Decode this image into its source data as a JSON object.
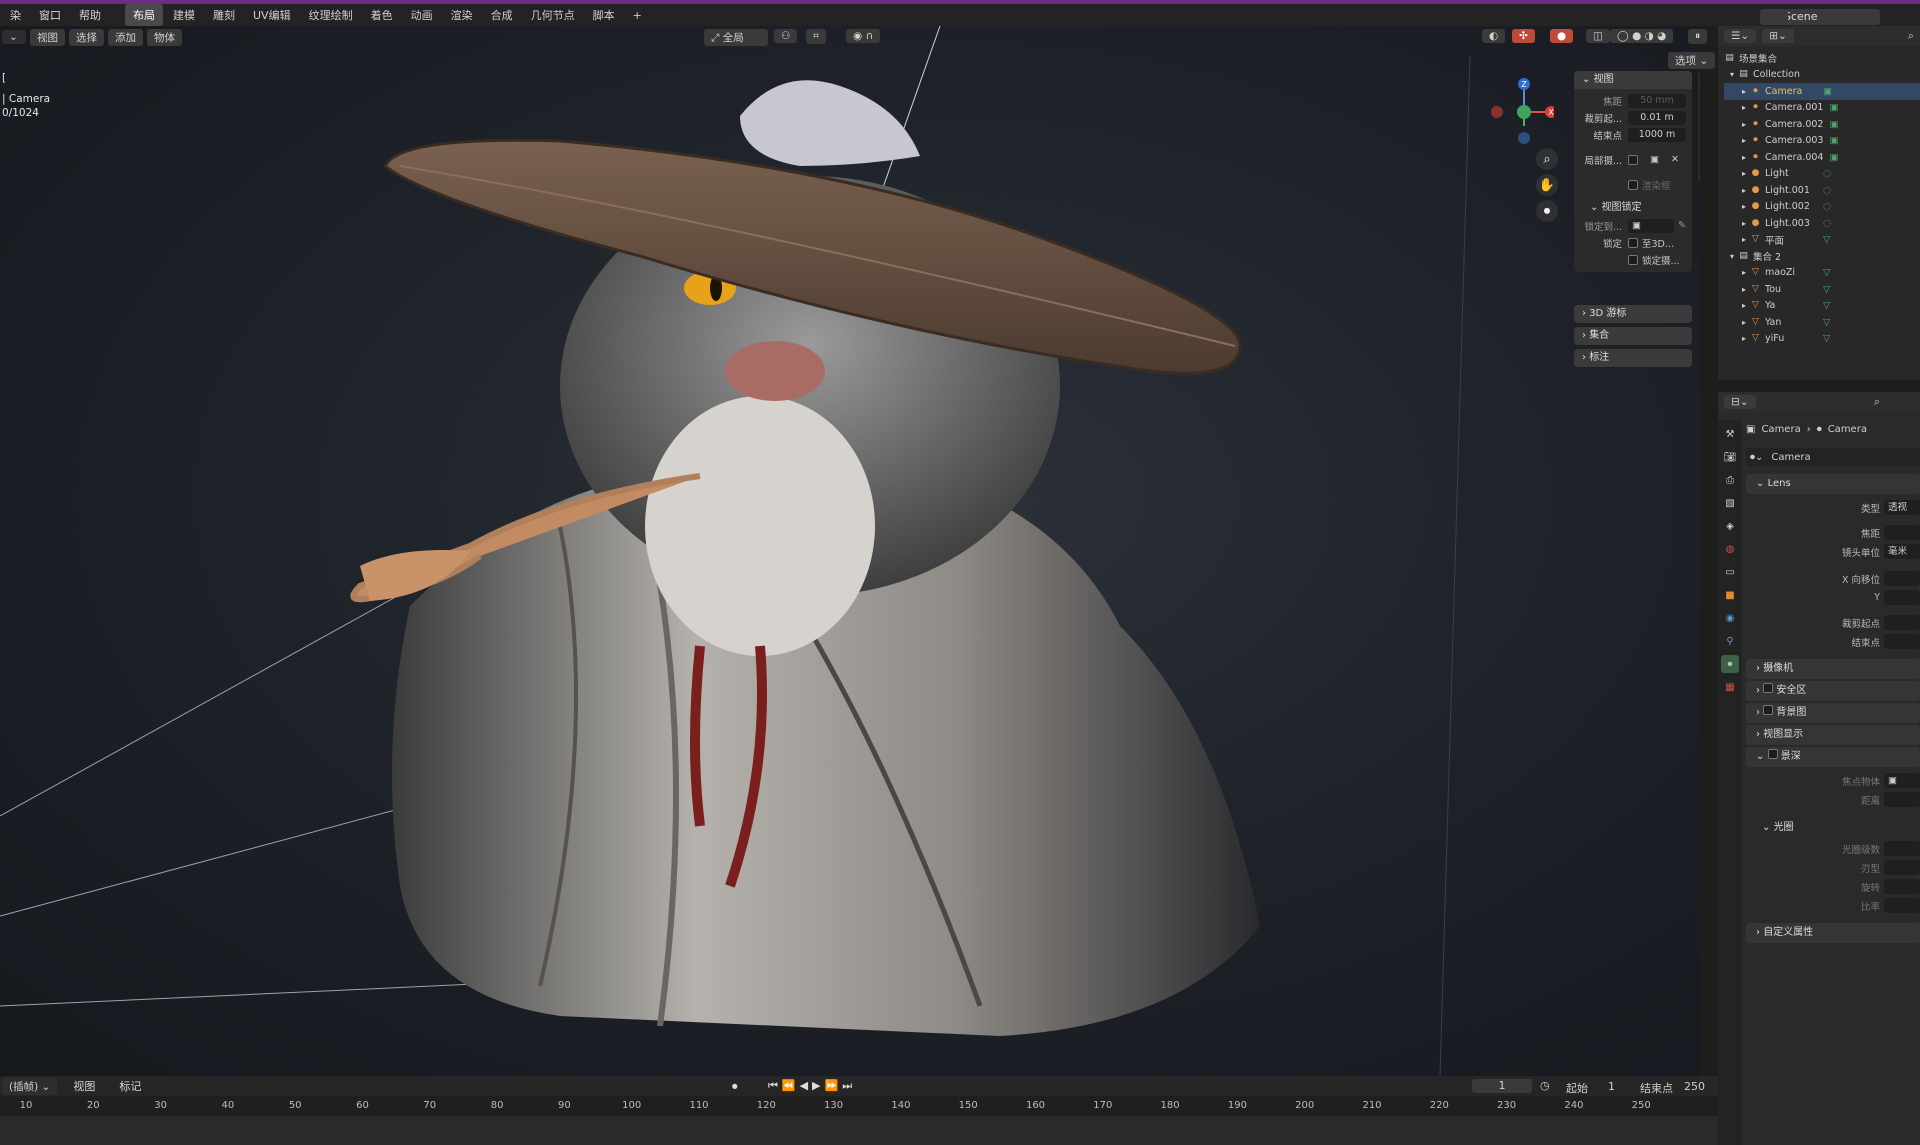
{
  "menus": [
    "染",
    "窗口",
    "帮助"
  ],
  "workspaces": [
    "布局",
    "建模",
    "雕刻",
    "UV编辑",
    "纹理绘制",
    "着色",
    "动画",
    "渲染",
    "合成",
    "几何节点",
    "脚本"
  ],
  "active_workspace": "布局",
  "add_tab": "+",
  "scene_name": "Scene",
  "viewport": {
    "header_items": [
      "视图",
      "选择",
      "添加",
      "物体"
    ],
    "transform_label": "全局",
    "options_label": "选项",
    "overlay_text": [
      "[",
      "| Camera",
      "0/1024"
    ]
  },
  "npanel": {
    "view_header": "视图",
    "focal_label": "焦距",
    "focal_value": "50 mm",
    "clip_start_label": "裁剪起...",
    "clip_start_value": "0.01 m",
    "clip_end_label": "结束点",
    "clip_end_value": "1000 m",
    "local_camera_label": "局部摄...",
    "render_region_label": "渲染框",
    "view_lock_header": "视图锁定",
    "lock_to_label": "锁定到...",
    "lock_label": "锁定",
    "lock_3d_label": "至3D...",
    "lock_camera_label": "锁定摄...",
    "cursor_header": "3D 游标",
    "collections_header": "集合",
    "annotations_header": "标注"
  },
  "outliner": {
    "root": "场景集合",
    "collection1": "Collection",
    "items1": [
      {
        "name": "Camera",
        "type": "camera",
        "selected": true
      },
      {
        "name": "Camera.001",
        "type": "camera"
      },
      {
        "name": "Camera.002",
        "type": "camera"
      },
      {
        "name": "Camera.003",
        "type": "camera"
      },
      {
        "name": "Camera.004",
        "type": "camera"
      },
      {
        "name": "Light",
        "type": "light"
      },
      {
        "name": "Light.001",
        "type": "light"
      },
      {
        "name": "Light.002",
        "type": "light"
      },
      {
        "name": "Light.003",
        "type": "light"
      },
      {
        "name": "平面",
        "type": "mesh"
      }
    ],
    "collection2": "集合 2",
    "items2": [
      {
        "name": "maoZi",
        "type": "mesh"
      },
      {
        "name": "Tou",
        "type": "mesh"
      },
      {
        "name": "Ya",
        "type": "mesh"
      },
      {
        "name": "Yan",
        "type": "mesh"
      },
      {
        "name": "yiFu",
        "type": "mesh"
      }
    ]
  },
  "properties": {
    "breadcrumb_a": "Camera",
    "breadcrumb_b": "Camera",
    "datablock": "Camera",
    "lens_header": "Lens",
    "type_label": "类型",
    "type_value": "透视",
    "focal_label": "焦距",
    "lens_unit_label": "镜头单位",
    "lens_unit_value": "毫米",
    "shift_x_label": "X 向移位",
    "shift_y_label": "Y",
    "clip_start_label": "裁剪起点",
    "clip_end_label": "结束点",
    "camera_header": "摄像机",
    "safe_areas_header": "安全区",
    "background_header": "背景图",
    "viewport_display_header": "视图显示",
    "dof_header": "景深",
    "focus_object_label": "焦点物体",
    "distance_label": "距离",
    "aperture_header": "光圈",
    "fstop_label": "光圈级数",
    "blades_label": "刃型",
    "rotation_label": "旋转",
    "ratio_label": "比率",
    "custom_props_header": "自定义属性"
  },
  "timeline": {
    "mode_label": "(插帧)",
    "view_label": "视图",
    "marker_label": "标记",
    "current_frame": "1",
    "start_label": "起始",
    "start_value": "1",
    "end_label": "结束点",
    "end_value": "250",
    "ticks": [
      "10",
      "20",
      "30",
      "40",
      "50",
      "60",
      "70",
      "80",
      "90",
      "100",
      "110",
      "120",
      "130",
      "140",
      "150",
      "160",
      "170",
      "180",
      "190",
      "200",
      "210",
      "220",
      "230",
      "240",
      "250"
    ]
  },
  "colors": {
    "accent": "#6d2a86",
    "selected": "#f2c04a",
    "hat": "#6b5445"
  }
}
